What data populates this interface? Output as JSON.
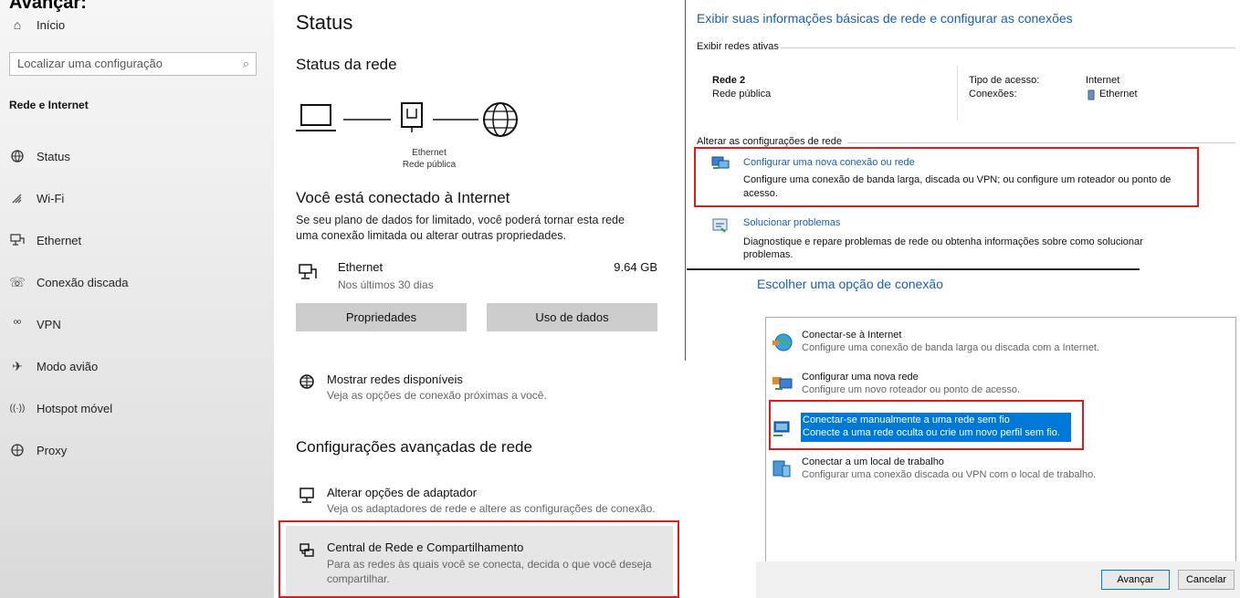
{
  "caption": "Avançar:",
  "sidebar": {
    "home": {
      "icon": "home-icon",
      "label": "Início"
    },
    "search_placeholder": "Localizar uma configuração",
    "section": "Rede e Internet",
    "items": [
      {
        "icon": "status-globe-icon",
        "label": "Status"
      },
      {
        "icon": "wifi-icon",
        "label": "Wi-Fi"
      },
      {
        "icon": "ethernet-icon",
        "label": "Ethernet"
      },
      {
        "icon": "dialup-icon",
        "label": "Conexão discada"
      },
      {
        "icon": "vpn-icon",
        "label": "VPN"
      },
      {
        "icon": "airplane-icon",
        "label": "Modo avião"
      },
      {
        "icon": "hotspot-icon",
        "label": "Hotspot móvel"
      },
      {
        "icon": "globe-icon",
        "label": "Proxy"
      }
    ]
  },
  "status": {
    "title": "Status",
    "network_status": "Status da rede",
    "diagram": {
      "adapter": "Ethernet",
      "profile": "Rede pública"
    },
    "connected": "Você está conectado à Internet",
    "metered_text_1": "Se seu plano de dados for limitado, você poderá tornar esta rede",
    "metered_text_2": "uma conexão limitada ou alterar outras propriedades.",
    "usage": {
      "name": "Ethernet",
      "period": "Nos últimos 30 dias",
      "amount": "9.64 GB"
    },
    "buttons": {
      "properties": "Propriedades",
      "data_usage": "Uso de dados"
    },
    "show_networks": {
      "title": "Mostrar redes disponíveis",
      "desc": "Veja as opções de conexão próximas a você."
    },
    "advanced": "Configurações avançadas de rede",
    "adapter_options": {
      "title": "Alterar opções de adaptador",
      "desc": "Veja os adaptadores de rede e altere as configurações de conexão."
    },
    "sharing_center": {
      "title": "Central de Rede e Compartilhamento",
      "desc_1": "Para as redes às quais você se conecta, decida o que você deseja",
      "desc_2": "compartilhar."
    }
  },
  "network_center": {
    "heading": "Exibir suas informações básicas de rede e configurar as conexões",
    "active_networks": "Exibir redes ativas",
    "network_name": "Rede 2",
    "network_type": "Rede pública",
    "access_type_label": "Tipo de acesso:",
    "access_type_value": "Internet",
    "connections_label": "Conexões:",
    "connections_value": "Ethernet",
    "change_settings": "Alterar as configurações de rede",
    "new_connection": {
      "title": "Configurar uma nova conexão ou rede",
      "desc_1": "Configure uma conexão de banda larga, discada ou VPN; ou configure um roteador ou ponto de",
      "desc_2": "acesso."
    },
    "troubleshoot": {
      "title": "Solucionar problemas",
      "desc_1": "Diagnostique e repare problemas de rede ou obtenha informações sobre como solucionar",
      "desc_2": "problemas."
    }
  },
  "wizard": {
    "heading": "Escolher uma opção de conexão",
    "options": [
      {
        "title": "Conectar-se à Internet",
        "desc": "Configure uma conexão de banda larga ou discada com a Internet."
      },
      {
        "title": "Configurar uma nova rede",
        "desc": "Configure um novo roteador ou ponto de acesso."
      },
      {
        "title": "Conectar-se manualmente a uma rede sem fio",
        "desc": "Conecte a uma rede oculta ou crie um novo perfil sem fio."
      },
      {
        "title": "Conectar a um local de trabalho",
        "desc": "Configurar uma conexão discada ou VPN com o local de trabalho."
      }
    ],
    "next": "Avançar",
    "cancel": "Cancelar"
  }
}
